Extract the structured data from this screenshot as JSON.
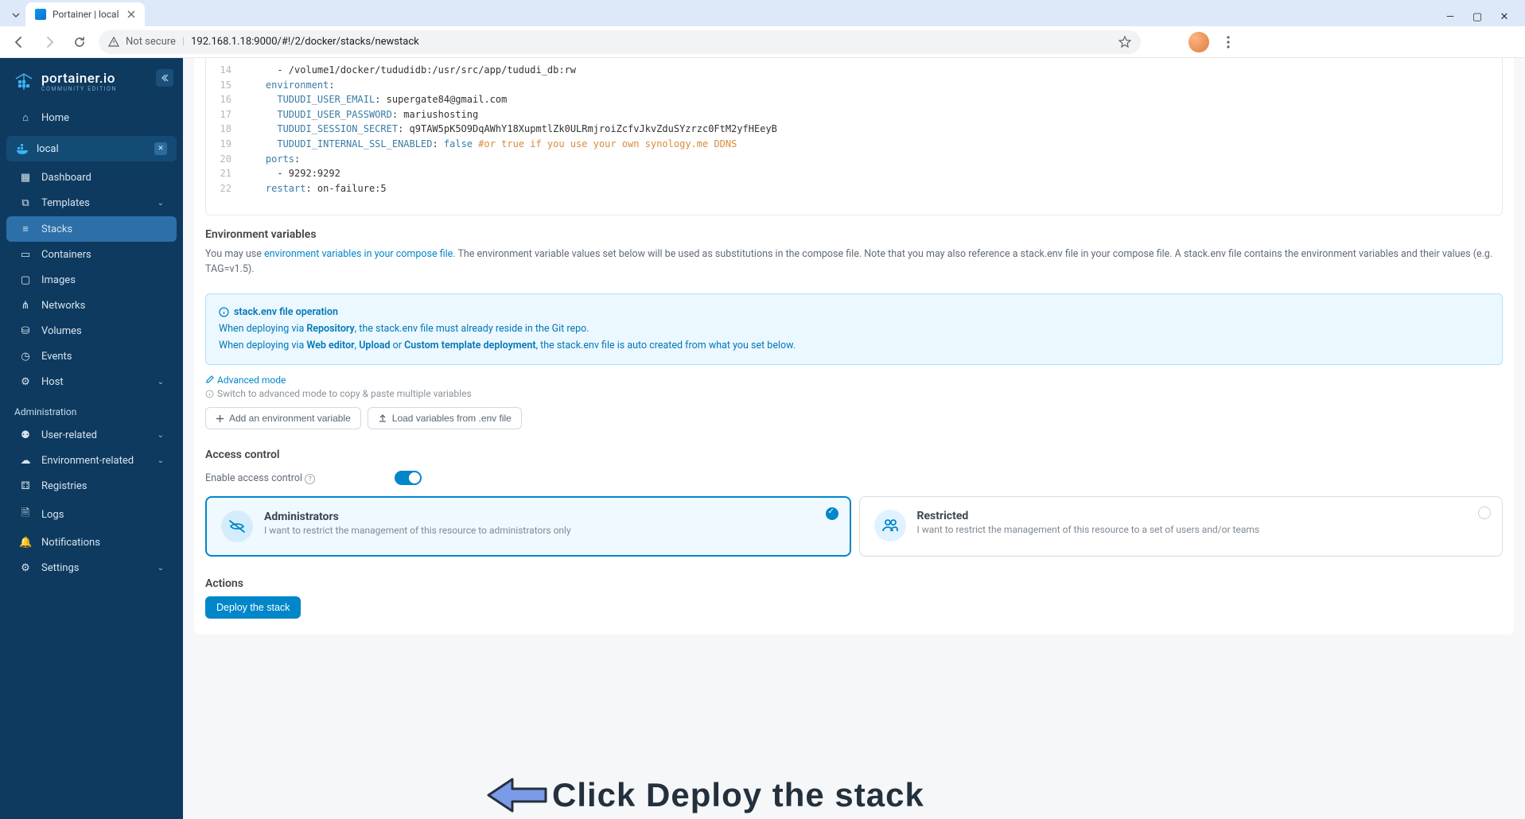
{
  "browser": {
    "tab_title": "Portainer | local",
    "url_security": "Not secure",
    "url": "192.168.1.18:9000/#!/2/docker/stacks/newstack"
  },
  "sidebar": {
    "brand": "portainer.io",
    "brand_sub": "COMMUNITY EDITION",
    "home": "Home",
    "env_name": "local",
    "items": [
      {
        "label": "Dashboard"
      },
      {
        "label": "Templates",
        "chev": true
      },
      {
        "label": "Stacks",
        "active": true
      },
      {
        "label": "Containers"
      },
      {
        "label": "Images"
      },
      {
        "label": "Networks"
      },
      {
        "label": "Volumes"
      },
      {
        "label": "Events"
      },
      {
        "label": "Host",
        "chev": true
      }
    ],
    "admin_label": "Administration",
    "admin_items": [
      {
        "label": "User-related",
        "chev": true
      },
      {
        "label": "Environment-related",
        "chev": true
      },
      {
        "label": "Registries"
      },
      {
        "label": "Logs"
      },
      {
        "label": "Notifications"
      },
      {
        "label": "Settings",
        "chev": true
      }
    ]
  },
  "editor": {
    "lines": [
      {
        "n": 14,
        "indent": "      ",
        "text": "- /volume1/docker/tududidb:/usr/src/app/tududi_db:rw"
      },
      {
        "n": 15,
        "indent": "    ",
        "key": "environment",
        "after": ":"
      },
      {
        "n": 16,
        "indent": "      ",
        "key": "TUDUDI_USER_EMAIL",
        "after": ": supergate84@gmail.com"
      },
      {
        "n": 17,
        "indent": "      ",
        "key": "TUDUDI_USER_PASSWORD",
        "after": ": mariushosting"
      },
      {
        "n": 18,
        "indent": "      ",
        "key": "TUDUDI_SESSION_SECRET",
        "after": ": q9TAW5pK5O9DqAWhY18XupmtlZk0ULRmjroiZcfvJkvZduSYzrzc0FtM2yfHEeyB"
      },
      {
        "n": 19,
        "indent": "      ",
        "key": "TUDUDI_INTERNAL_SSL_ENABLED",
        "after": ": ",
        "bool": "false",
        "comment": " #or true if you use your own synology.me DDNS"
      },
      {
        "n": 20,
        "indent": "    ",
        "key": "ports",
        "after": ":"
      },
      {
        "n": 21,
        "indent": "      ",
        "text": "- 9292:9292"
      },
      {
        "n": 22,
        "indent": "    ",
        "key": "restart",
        "after": ": on-failure:5"
      }
    ]
  },
  "env": {
    "title": "Environment variables",
    "desc_pre": "You may use ",
    "desc_link": "environment variables in your compose file",
    "desc_post": ". The environment variable values set below will be used as substitutions in the compose file. Note that you may also reference a stack.env file in your compose file. A stack.env file contains the environment variables and their values (e.g. TAG=v1.5).",
    "info_title": "stack.env file operation",
    "info_l1a": "When deploying via ",
    "info_l1b": "Repository",
    "info_l1c": ", the stack.env file must already reside in the Git repo.",
    "info_l2a": "When deploying via ",
    "info_l2b": "Web editor",
    "info_l2c": ", ",
    "info_l2d": "Upload",
    "info_l2e": " or ",
    "info_l2f": "Custom template deployment",
    "info_l2g": ", the stack.env file is auto created from what you set below.",
    "adv_link": "Advanced mode",
    "adv_help": "Switch to advanced mode to copy & paste multiple variables",
    "btn_add": "Add an environment variable",
    "btn_load": "Load variables from .env file"
  },
  "access": {
    "title": "Access control",
    "toggle_label": "Enable access control",
    "cards": [
      {
        "title": "Administrators",
        "desc": "I want to restrict the management of this resource to administrators only",
        "selected": true
      },
      {
        "title": "Restricted",
        "desc": "I want to restrict the management of this resource to a set of users and/or teams",
        "selected": false
      }
    ]
  },
  "actions": {
    "title": "Actions",
    "deploy": "Deploy the stack"
  },
  "annotation": {
    "text": "Click Deploy the stack"
  }
}
